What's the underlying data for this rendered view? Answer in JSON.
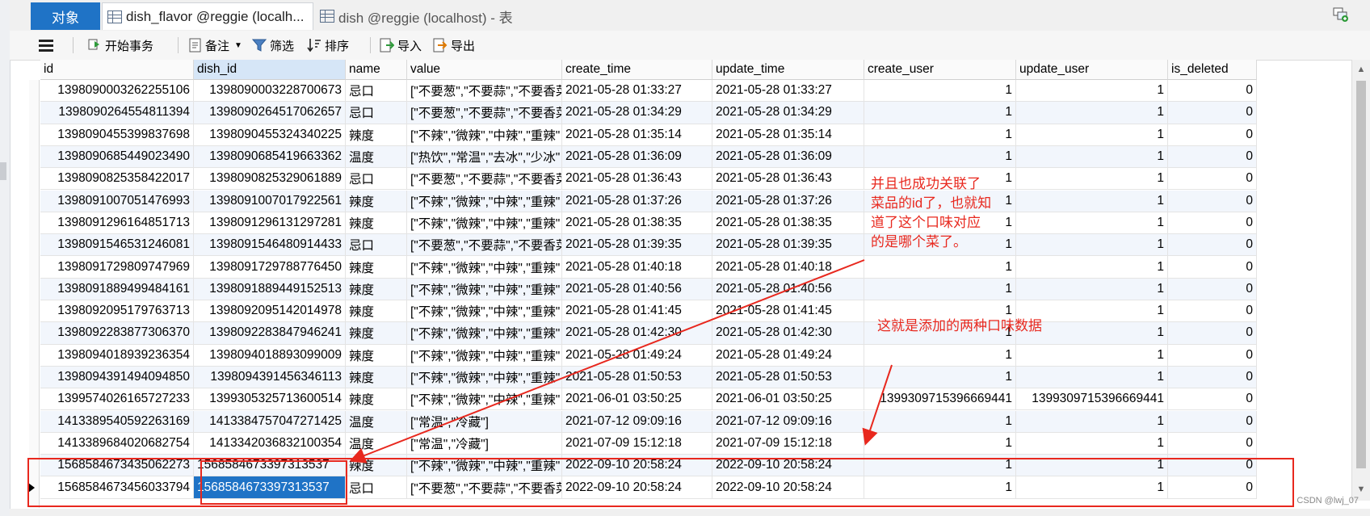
{
  "tabs": {
    "objects": "对象",
    "tab1": "dish_flavor @reggie (localh...",
    "tab2": "dish @reggie (localhost) - 表"
  },
  "toolbar": {
    "begin_transaction": "开始事务",
    "memo": "备注",
    "filter": "筛选",
    "sort": "排序",
    "import": "导入",
    "export": "导出"
  },
  "columns": [
    "id",
    "dish_id",
    "name",
    "value",
    "create_time",
    "update_time",
    "create_user",
    "update_user",
    "is_deleted"
  ],
  "rows": [
    [
      "1398090003262255106",
      "1398090003228700673",
      "忌口",
      "[\"不要葱\",\"不要蒜\",\"不要香菜",
      "2021-05-28 01:33:27",
      "2021-05-28 01:33:27",
      "1",
      "1",
      "0"
    ],
    [
      "1398090264554811394",
      "1398090264517062657",
      "忌口",
      "[\"不要葱\",\"不要蒜\",\"不要香菜",
      "2021-05-28 01:34:29",
      "2021-05-28 01:34:29",
      "1",
      "1",
      "0"
    ],
    [
      "1398090455399837698",
      "1398090455324340225",
      "辣度",
      "[\"不辣\",\"微辣\",\"中辣\",\"重辣\"",
      "2021-05-28 01:35:14",
      "2021-05-28 01:35:14",
      "1",
      "1",
      "0"
    ],
    [
      "1398090685449023490",
      "1398090685419663362",
      "温度",
      "[\"热饮\",\"常温\",\"去冰\",\"少冰\"",
      "2021-05-28 01:36:09",
      "2021-05-28 01:36:09",
      "1",
      "1",
      "0"
    ],
    [
      "1398090825358422017",
      "1398090825329061889",
      "忌口",
      "[\"不要葱\",\"不要蒜\",\"不要香菜",
      "2021-05-28 01:36:43",
      "2021-05-28 01:36:43",
      "1",
      "1",
      "0"
    ],
    [
      "1398091007051476993",
      "1398091007017922561",
      "辣度",
      "[\"不辣\",\"微辣\",\"中辣\",\"重辣\"",
      "2021-05-28 01:37:26",
      "2021-05-28 01:37:26",
      "1",
      "1",
      "0"
    ],
    [
      "1398091296164851713",
      "1398091296131297281",
      "辣度",
      "[\"不辣\",\"微辣\",\"中辣\",\"重辣\"",
      "2021-05-28 01:38:35",
      "2021-05-28 01:38:35",
      "1",
      "1",
      "0"
    ],
    [
      "1398091546531246081",
      "1398091546480914433",
      "忌口",
      "[\"不要葱\",\"不要蒜\",\"不要香菜",
      "2021-05-28 01:39:35",
      "2021-05-28 01:39:35",
      "1",
      "1",
      "0"
    ],
    [
      "1398091729809747969",
      "1398091729788776450",
      "辣度",
      "[\"不辣\",\"微辣\",\"中辣\",\"重辣\"",
      "2021-05-28 01:40:18",
      "2021-05-28 01:40:18",
      "1",
      "1",
      "0"
    ],
    [
      "1398091889499484161",
      "1398091889449152513",
      "辣度",
      "[\"不辣\",\"微辣\",\"中辣\",\"重辣\"",
      "2021-05-28 01:40:56",
      "2021-05-28 01:40:56",
      "1",
      "1",
      "0"
    ],
    [
      "1398092095179763713",
      "1398092095142014978",
      "辣度",
      "[\"不辣\",\"微辣\",\"中辣\",\"重辣\"",
      "2021-05-28 01:41:45",
      "2021-05-28 01:41:45",
      "1",
      "1",
      "0"
    ],
    [
      "1398092283877306370",
      "1398092283847946241",
      "辣度",
      "[\"不辣\",\"微辣\",\"中辣\",\"重辣\"",
      "2021-05-28 01:42:30",
      "2021-05-28 01:42:30",
      "1",
      "1",
      "0"
    ],
    [
      "1398094018939236354",
      "1398094018893099009",
      "辣度",
      "[\"不辣\",\"微辣\",\"中辣\",\"重辣\"",
      "2021-05-28 01:49:24",
      "2021-05-28 01:49:24",
      "1",
      "1",
      "0"
    ],
    [
      "1398094391494094850",
      "1398094391456346113",
      "辣度",
      "[\"不辣\",\"微辣\",\"中辣\",\"重辣\"",
      "2021-05-28 01:50:53",
      "2021-05-28 01:50:53",
      "1",
      "1",
      "0"
    ],
    [
      "1399574026165727233",
      "1399305325713600514",
      "辣度",
      "[\"不辣\",\"微辣\",\"中辣\",\"重辣\"",
      "2021-06-01 03:50:25",
      "2021-06-01 03:50:25",
      "1399309715396669441",
      "1399309715396669441",
      "0"
    ],
    [
      "1413389540592263169",
      "1413384757047271425",
      "温度",
      "[\"常温\",\"冷藏\"]",
      "2021-07-12 09:09:16",
      "2021-07-12 09:09:16",
      "1",
      "1",
      "0"
    ],
    [
      "1413389684020682754",
      "1413342036832100354",
      "温度",
      "[\"常温\",\"冷藏\"]",
      "2021-07-09 15:12:18",
      "2021-07-09 15:12:18",
      "1",
      "1",
      "0"
    ],
    [
      "1568584673435062273",
      "1568584673397313537",
      "辣度",
      "[\"不辣\",\"微辣\",\"中辣\",\"重辣\"",
      "2022-09-10 20:58:24",
      "2022-09-10 20:58:24",
      "1",
      "1",
      "0"
    ],
    [
      "1568584673456033794",
      "1568584673397313537",
      "忌口",
      "[\"不要葱\",\"不要蒜\",\"不要香菜",
      "2022-09-10 20:58:24",
      "2022-09-10 20:58:24",
      "1",
      "1",
      "0"
    ]
  ],
  "annotations": {
    "note1": "并且也成功关联了菜品的id了，也就知道了这个口味对应的是哪个菜了。",
    "note2": "这就是添加的两种口味数据"
  },
  "watermark": "CSDN @lwj_07",
  "colors": {
    "accent": "#1f73c6",
    "annotation": "#e8281e"
  }
}
